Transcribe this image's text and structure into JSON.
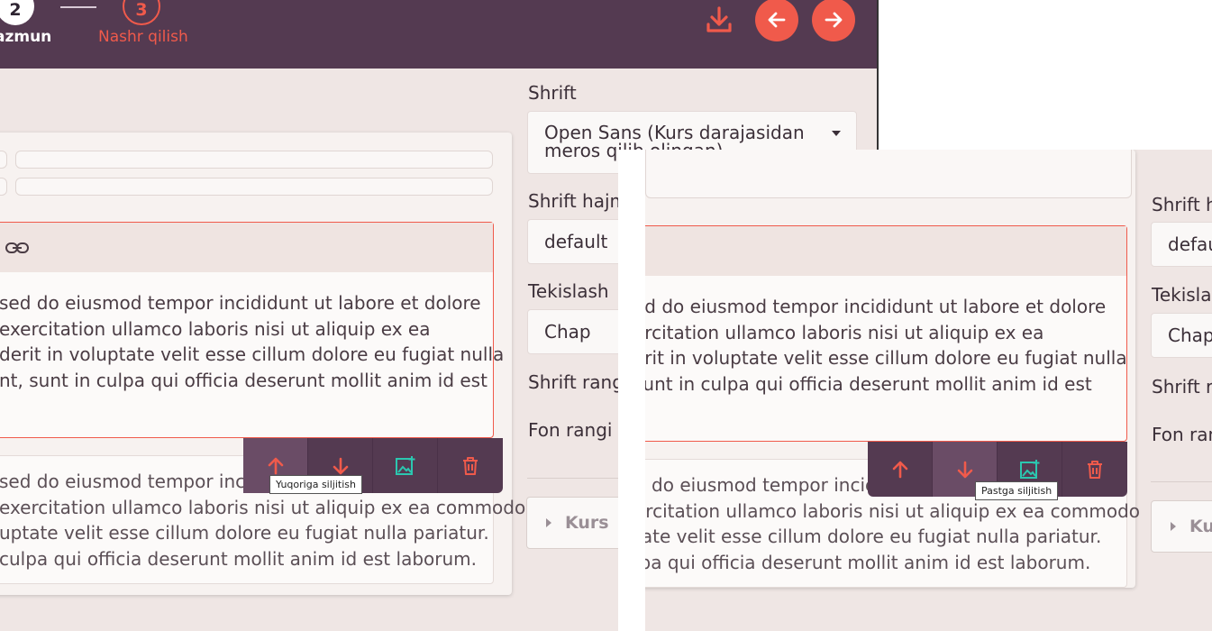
{
  "stepper": {
    "step2_number": "2",
    "step2_label": "azmun",
    "step3_number": "3",
    "step3_label": "Nashr qilish"
  },
  "header_icons": {
    "download": "download-icon",
    "prev": "arrow-left-icon",
    "next": "arrow-right-icon"
  },
  "colors": {
    "header": "#543a51",
    "accent": "#f05a4b",
    "background": "#efe6e4",
    "teal": "#2bc7b0"
  },
  "editor": {
    "link_icon": "link-icon",
    "paragraph_lines": [
      "sed do eiusmod tempor incididunt ut labore et dolore",
      "exercitation ullamco laboris nisi ut aliquip ex ea",
      "derit in voluptate velit esse cillum dolore eu fugiat nulla",
      "nt, sunt in culpa qui officia deserunt mollit anim id est"
    ],
    "lower_lines": [
      "sed do eiusmod tempor incic",
      "exercitation ullamco laboris nisi ut aliquip ex ea commodo",
      "uptate velit esse cillum dolore eu fugiat nulla pariatur.",
      "culpa qui officia deserunt mollit anim id est laborum."
    ],
    "toolbar": {
      "move_up": "arrow-up-icon",
      "move_down": "arrow-down-icon",
      "add_image": "add-image-icon",
      "delete": "trash-icon"
    },
    "tooltip_up": "Yuqoriga siljitish"
  },
  "side_panel": {
    "font_label": "Shrift",
    "font_value_line1": "Open Sans (Kurs darajasidan",
    "font_value_line2": "meros qilib olingan)",
    "font_size_label": "Shrift hajm",
    "font_size_value": "default",
    "align_label": "Tekislash",
    "align_value": "Chap",
    "font_color_label": "Shrift rang",
    "bg_color_label": "Fon rangi",
    "collapse_label": "Kurs"
  },
  "overlay": {
    "paragraph_lines": [
      "ed do eiusmod tempor incididunt ut labore et dolore",
      "ercitation ullamco laboris nisi ut aliquip ex ea",
      "erit in voluptate velit esse cillum dolore eu fugiat nulla",
      "sunt in culpa qui officia deserunt mollit anim id est"
    ],
    "lower_lines": [
      "d do eiusmod tempor incic",
      "ercitation ullamco laboris nisi ut aliquip ex ea commodo",
      "tate velit esse cillum dolore eu fugiat nulla pariatur.",
      "lpa qui officia deserunt mollit anim id est laborum."
    ],
    "tooltip_down": "Pastga siljitish",
    "side": {
      "font_size_label": "Shrift h",
      "font_size_value": "defau",
      "align_label": "Tekislas",
      "align_value": "Chap",
      "font_color_label": "Shrift ra",
      "bg_color_label": "Fon ran",
      "collapse_label": "Ku"
    }
  }
}
